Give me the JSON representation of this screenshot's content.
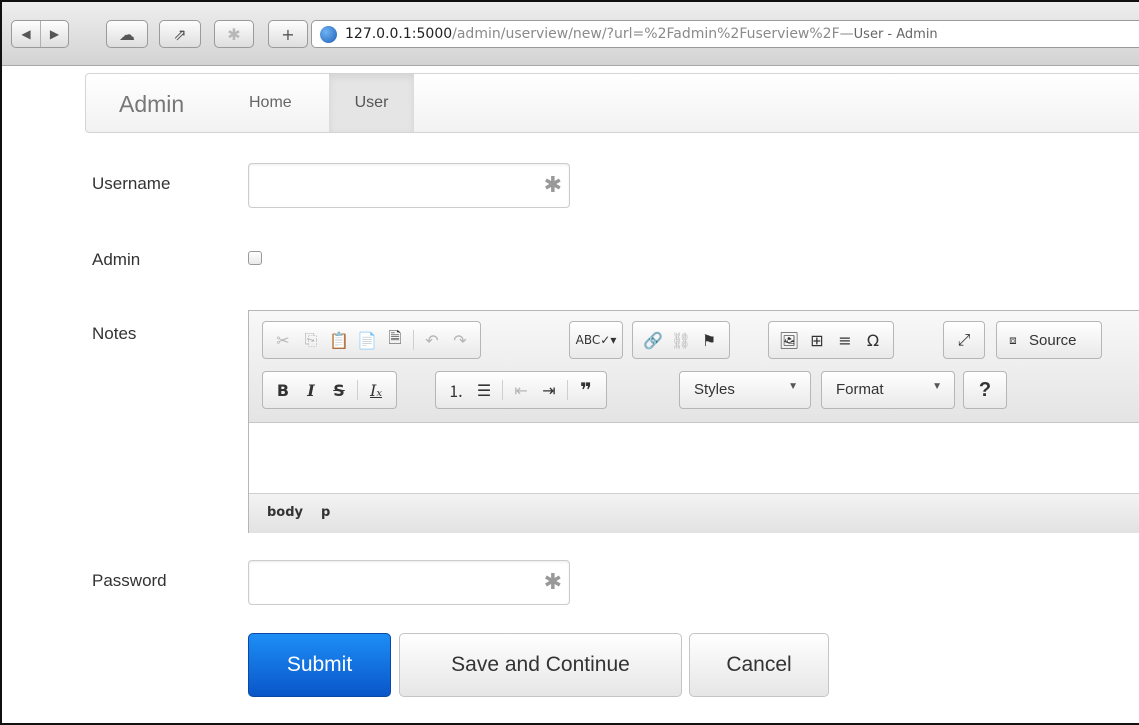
{
  "browser": {
    "url_host": "127.0.0.1:5000",
    "url_path": "/admin/userview/new/?url=%2Fadmin%2Fuserview%2F",
    "title_separator": " — ",
    "page_title": "User - Admin"
  },
  "navbar": {
    "brand": "Admin",
    "links": [
      "Home",
      "User"
    ],
    "active": "User"
  },
  "form": {
    "username_label": "Username",
    "username_value": "",
    "admin_label": "Admin",
    "admin_checked": false,
    "notes_label": "Notes",
    "password_label": "Password",
    "password_value": "",
    "required_marker": "✱"
  },
  "editor": {
    "source_label": "Source",
    "styles_label": "Styles",
    "format_label": "Format",
    "help_label": "?",
    "elements_path": [
      "body",
      "p"
    ]
  },
  "buttons": {
    "submit": "Submit",
    "save_continue": "Save and Continue",
    "cancel": "Cancel"
  },
  "colors": {
    "primary": "#0a6fe0",
    "navbar_active": "#e5e5e5"
  }
}
